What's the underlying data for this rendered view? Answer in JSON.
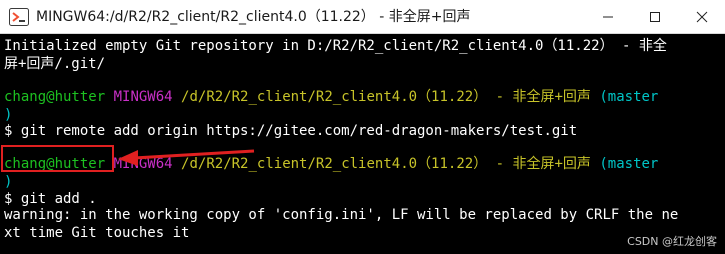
{
  "window": {
    "title": "MINGW64:/d/R2/R2_client/R2_client4.0（11.22） - 非全屏+回声",
    "icon": "git-bash-icon",
    "controls": [
      "minimize-icon",
      "maximize-icon",
      "close-icon"
    ]
  },
  "terminal": {
    "init_line1": "Initialized empty Git repository in D:/R2/R2_client/R2_client4.0（11.22） - 非全",
    "init_line2": "屏+回声/.git/",
    "prompt1": {
      "user": "chang@hutter",
      "env": "MINGW64",
      "path": "/d/R2/R2_client/R2_client4.0（11.22） - 非全屏+回声",
      "branch_open": "(master",
      "branch_close": ")"
    },
    "cmd1": "$ git remote add origin https://gitee.com/red-dragon-makers/test.git",
    "prompt2": {
      "user": "chang@hutter",
      "env": "MINGW64",
      "path": "/d/R2/R2_client/R2_client4.0（11.22） - 非全屏+回声",
      "branch_open": "(master",
      "branch_close": ")"
    },
    "cmd2": "$ git add .",
    "warn_line1": "warning: in the working copy of 'config.ini', LF will be replaced by CRLF the ne",
    "warn_line2": "xt time Git touches it"
  },
  "watermark": "CSDN @红龙创客",
  "colors": {
    "prompt_user": "#1dc121",
    "prompt_env": "#c930c7",
    "prompt_path": "#c7c329",
    "prompt_branch": "#00c5c7",
    "annotation": "#e02020"
  }
}
